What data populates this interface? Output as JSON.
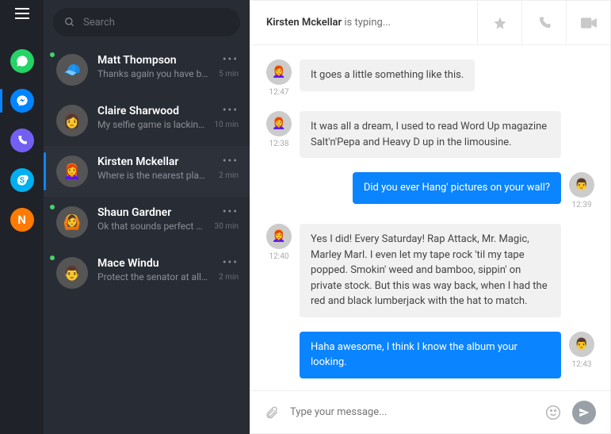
{
  "search": {
    "placeholder": "Search"
  },
  "rail": {
    "apps": [
      "whatsapp",
      "messenger",
      "viber",
      "skype",
      "n"
    ],
    "active": "messenger"
  },
  "chats": [
    {
      "name": "Matt Thompson",
      "preview": "Thanks again you have been…",
      "time": "5 min",
      "online": true
    },
    {
      "name": "Claire Sharwood",
      "preview": "My selfie game is lacking can…",
      "time": "10 min",
      "online": false
    },
    {
      "name": "Kirsten Mckellar",
      "preview": "Where is the nearest place to…",
      "time": "2 min",
      "online": false,
      "active": true
    },
    {
      "name": "Shaun Gardner",
      "preview": "Ok that sounds perfect 👍",
      "time": "30 min",
      "online": true
    },
    {
      "name": "Mace Windu",
      "preview": "Protect the senator at all costs.",
      "time": "2 min",
      "online": true
    }
  ],
  "header": {
    "name": "Kirsten Mckellar",
    "status": "is typing..."
  },
  "messages": [
    {
      "side": "left",
      "text": "It goes a little something like this.",
      "time": "12:47"
    },
    {
      "side": "left",
      "text": "It was all a dream, I used to read Word Up magazine Salt'n'Pepa and Heavy D up in the limousine.",
      "time": "12:38"
    },
    {
      "side": "right",
      "text": "Did you ever Hang' pictures on your wall?",
      "time": "12:39"
    },
    {
      "side": "left",
      "text": "Yes I did! Every Saturday! Rap Attack, Mr. Magic, Marley Marl. I even let my tape rock 'til my tape popped. Smokin' weed and bamboo, sippin' on private stock.  But this was way back, when I had the red and black lumberjack with the hat to match.",
      "time": "12:40"
    },
    {
      "side": "right",
      "text": "Haha awesome,  I think I know the album your looking.",
      "time": "12:43"
    }
  ],
  "composer": {
    "placeholder": "Type your message..."
  },
  "colors": {
    "accent": "#0a84ff"
  }
}
